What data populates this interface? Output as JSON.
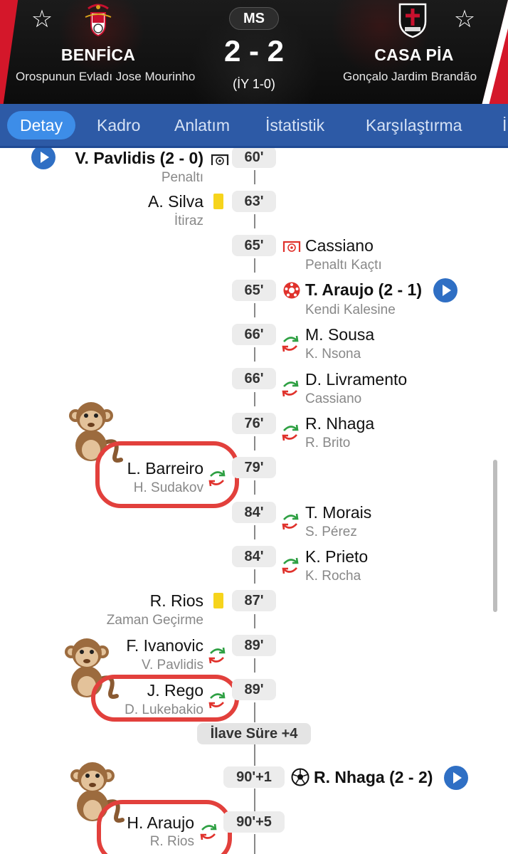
{
  "match": {
    "status": "MS",
    "score": "2 - 2",
    "halftime": "(İY 1-0)",
    "home": {
      "name": "BENFİCA",
      "coach": "Orospunun Evladı Jose Mourinho"
    },
    "away": {
      "name": "CASA PİA",
      "coach": "Gonçalo Jardim Brandão"
    }
  },
  "tabs": [
    {
      "label": "Detay",
      "active": true
    },
    {
      "label": "Kadro"
    },
    {
      "label": "Anlatım"
    },
    {
      "label": "İstatistik"
    },
    {
      "label": "Karşılaştırma"
    },
    {
      "label": "İ"
    }
  ],
  "events": [
    {
      "minute": "60'",
      "side": "home",
      "type": "penalty-goal",
      "name": "V. Pavlidis (2 - 0)",
      "detail": "Penaltı",
      "video": true
    },
    {
      "minute": "63'",
      "side": "home",
      "type": "yellow-card",
      "name": "A. Silva",
      "detail": "İtiraz"
    },
    {
      "minute": "65'",
      "side": "away",
      "type": "missed-penalty",
      "name": "Cassiano",
      "detail": "Penaltı Kaçtı"
    },
    {
      "minute": "65'",
      "side": "away",
      "type": "own-goal",
      "name": "T. Araujo (2 - 1)",
      "detail": "Kendi Kalesine",
      "video": true
    },
    {
      "minute": "66'",
      "side": "away",
      "type": "substitution",
      "name": "M. Sousa",
      "detail": "K. Nsona"
    },
    {
      "minute": "66'",
      "side": "away",
      "type": "substitution",
      "name": "D. Livramento",
      "detail": "Cassiano"
    },
    {
      "minute": "76'",
      "side": "away",
      "type": "substitution",
      "name": "R. Nhaga",
      "detail": "R. Brito"
    },
    {
      "minute": "79'",
      "side": "home",
      "type": "substitution",
      "name": "L. Barreiro",
      "detail": "H. Sudakov",
      "highlighted": true
    },
    {
      "minute": "84'",
      "side": "away",
      "type": "substitution",
      "name": "T. Morais",
      "detail": "S. Pérez"
    },
    {
      "minute": "84'",
      "side": "away",
      "type": "substitution",
      "name": "K. Prieto",
      "detail": "K. Rocha"
    },
    {
      "minute": "87'",
      "side": "home",
      "type": "yellow-card",
      "name": "R. Rios",
      "detail": "Zaman Geçirme"
    },
    {
      "minute": "89'",
      "side": "home",
      "type": "substitution",
      "name": "F. Ivanovic",
      "detail": "V. Pavlidis"
    },
    {
      "minute": "89'",
      "side": "home",
      "type": "substitution",
      "name": "J. Rego",
      "detail": "D. Lukebakio",
      "highlighted": true
    },
    {
      "minute": "90'+1",
      "side": "away",
      "type": "goal",
      "name": "R. Nhaga (2 - 2)",
      "detail": "",
      "video": true
    },
    {
      "minute": "90'+5",
      "side": "home",
      "type": "substitution",
      "name": "H. Araujo",
      "detail": "R. Rios",
      "highlighted": true
    }
  ],
  "stoppage": "İlave Süre +4",
  "icons": {
    "favorite": "star-outline-icon",
    "play": "play-icon",
    "substitution": "substitution-arrows-icon",
    "yellow_card": "yellow-card-icon",
    "goal": "football-icon",
    "penalty_goal": "penalty-goal-icon",
    "missed_penalty": "missed-penalty-icon",
    "annotation": "monkey-emoji-icon"
  },
  "colors": {
    "tab_bar": "#2d5aa6",
    "tab_active": "#3d8de8",
    "brand_red": "#d4172a",
    "yellow_card": "#f6d41c",
    "sub_in": "#2ea043",
    "sub_out": "#e0322c",
    "annotation_ring": "#e2403c",
    "play_button": "#2f6fc4"
  }
}
